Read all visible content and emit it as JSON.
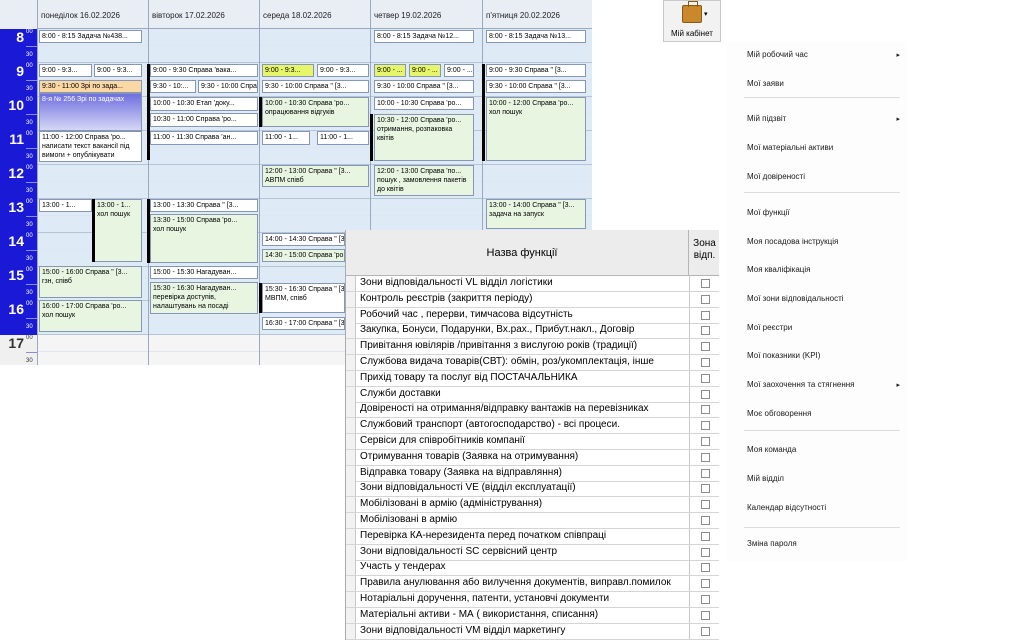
{
  "calendar": {
    "days": [
      "понеділок 16.02.2026",
      "вівторок 17.02.2026",
      "середа 18.02.2026",
      "четвер 19.02.2026",
      "п'ятниця 20.02.2026"
    ],
    "hours": [
      {
        "h": "8",
        "m": "00",
        "half": "30",
        "work": true
      },
      {
        "h": "9",
        "m": "00",
        "half": "30",
        "work": true
      },
      {
        "h": "10",
        "m": "00",
        "half": "30",
        "work": true
      },
      {
        "h": "11",
        "m": "00",
        "half": "30",
        "work": true
      },
      {
        "h": "12",
        "m": "00",
        "half": "30",
        "work": true
      },
      {
        "h": "13",
        "m": "00",
        "half": "30",
        "work": true
      },
      {
        "h": "14",
        "m": "00",
        "half": "30",
        "work": true
      },
      {
        "h": "15",
        "m": "00",
        "half": "30",
        "work": true
      },
      {
        "h": "16",
        "m": "00",
        "half": "30",
        "work": true
      },
      {
        "h": "17",
        "m": "00",
        "half": "30",
        "work": false
      }
    ],
    "events": {
      "mon_0800": "8:00 - 8:15 Задача №438...",
      "mon_0900a": "9:00 - 9:3...",
      "mon_0900b": "9:00 - 9:3...",
      "mon_0930": "9:30 - 11:00 Зрі по зада...",
      "mon_0945": "8-я № 256 Зрі по задачах",
      "mon_1100": "11:00 - 12:00 Справа 'ро...",
      "mon_1100_sub": "написати текст вакансії під вимоги + опублікувати",
      "mon_1300a": "13:00 - 1...",
      "mon_1300b": "13:00 - 1...",
      "mon_1300b_sub": "хол пошук",
      "mon_1500": "15:00 - 16:00 Справа \" [3...",
      "mon_1500_sub": "гзн, співб",
      "mon_1600": "16:00 - 17:00 Справа 'ро...",
      "mon_1600_sub": "хол пошук",
      "tue_0900": "9:00 - 9:30 Справа 'вака...",
      "tue_0930a": "9:30 - 10:...",
      "tue_0930b": "9:30 - 10:00 Справа \" [3...",
      "tue_1000": "10:00 - 10:30 Етап 'доку...",
      "tue_1030": "10:30 - 11:00 Справа 'ро...",
      "tue_1100": "11:00 - 11:30 Справа 'ан...",
      "tue_1300": "13:00 - 13:30 Справа \" [3...",
      "tue_1330": "13:30 - 15:00 Справа 'ро...",
      "tue_1330_sub": "хол пошук",
      "tue_1500": "15:00 - 15:30 Нагадуван...",
      "tue_1530": "15:30 - 16:30 Нагадуван...",
      "tue_1530_sub": "перевірка доступів, налаштувань на посаді",
      "wed_0900a": "9:00 - 9:3...",
      "wed_0900b": "9:00 - 9:3...",
      "wed_0930": "9:30 - 10:00 Справа \" [3...",
      "wed_1000": "10:00 - 10:30 Справа 'ро...",
      "wed_1000_sub": "опрацювання відгуків",
      "wed_1100a": "11:00 - 1...",
      "wed_1100b": "11:00 - 1...",
      "wed_1200": "12:00 - 13:00 Справа \" [3...",
      "wed_1200_sub": "АВПМ співб",
      "wed_1400": "14:00 - 14:30 Справа \" [3...",
      "wed_1430": "14:30 - 15:00 Справа 'ро...",
      "wed_1530": "15:30 - 16:30 Справа \" [3...",
      "wed_1530_sub": "МВПМ, співб",
      "wed_1630": "16:30 - 17:00 Справа \" [3...",
      "thu_0800": "8:00 - 8:15 Задача №12...",
      "thu_0900a": "9:00 - ...",
      "thu_0900b": "9:00 - ...",
      "thu_0900c": "9:00 - ...",
      "thu_0930": "9:30 - 10:00 Справа \" [3...",
      "thu_1000": "10:00 - 10:30 Справа 'ро...",
      "thu_1030": "10:30 - 12:00 Справа 'ро...",
      "thu_1030_sub": "отримання, розпаковка квітів",
      "thu_1200": "12:00 - 13:00 Справа 'по...",
      "thu_1200_sub": "пошук , замовлення пакетів до квітів",
      "fri_0800": "8:00 - 8:15 Задача №13...",
      "fri_0900": "9:00 - 9:30 Справа \" [3...",
      "fri_0930": "9:30 - 10:00 Справа \" [3...",
      "fri_1000": "10:00 - 12:00 Справа 'ро...",
      "fri_1000_sub": "хол пошук",
      "fri_1300": "13:00 - 14:00 Справа \" [3...",
      "fri_1300_sub": "задача на запуск"
    }
  },
  "cabinet_button": {
    "label": "Мій кабінет",
    "icon": "briefcase-icon"
  },
  "menu": {
    "items": [
      {
        "label": "Мій робочий час",
        "submenu": true
      },
      {
        "label": "Мої заяви",
        "submenu": false
      },
      {
        "label": "Мій підзвіт",
        "submenu": true
      },
      {
        "label": "Мої матеріальні активи",
        "submenu": false
      },
      {
        "label": "Мої довіреності",
        "submenu": false
      },
      {
        "label": "Мої функції",
        "submenu": false
      },
      {
        "label": "Моя посадова інструкція",
        "submenu": false
      },
      {
        "label": "Моя кваліфікація",
        "submenu": false
      },
      {
        "label": "Мої зони відповідальності",
        "submenu": false
      },
      {
        "label": "Мої реєстри",
        "submenu": false
      },
      {
        "label": "Мої показники (KPI)",
        "submenu": false
      },
      {
        "label": "Мої заохочення та стягнення",
        "submenu": true
      },
      {
        "label": "Моє обговорення",
        "submenu": false
      },
      {
        "label": "Моя команда",
        "submenu": false
      },
      {
        "label": "Мій відділ",
        "submenu": false
      },
      {
        "label": "Календар відсутності",
        "submenu": false
      },
      {
        "label": "Зміна пароля",
        "submenu": false
      }
    ],
    "arrow": "▸"
  },
  "functions_table": {
    "col_name": "Назва функції",
    "col_zone": "Зона відп.",
    "rows": [
      "Зони відповідальності  VL відділ логістики",
      "Контроль реєстрів (закриття періоду)",
      "Робочий час , перерви, тимчасова відсутність",
      "Закупка, Бонуси, Подарунки, Вх.рах., Прибут.накл., Договір",
      "Привітання ювілярів /привітання з вислугою років (традиції)",
      "Службова видача товарів(СВТ): обмін, роз/укомплектація, інше",
      "Прихід товару та послуг від ПОСТАЧАЛЬНИКА",
      "Служби доставки",
      "Довіреності на отримання/відправку вантажів на перевізниках",
      "Службовий транспорт (автогосподарство) - всі процеси.",
      "Сервіси для співробітників компанії",
      "Отримування товарів (Заявка на отримування)",
      "Відправка товару (Заявка на відправляння)",
      "Зони відповідальності VE  (відділ експлуатації)",
      "Мобілізовані в армію (адміністрування)",
      "Мобілізовані в армію",
      "Перевірка КА-нерезидента перед початком співпраці",
      "Зони відповідальності SC  сервісний центр",
      "Участь у тендерах",
      "Правила анулювання або вилучення документів, виправл.помилок",
      "Нотаріальні доручення, патенти, установчі документи",
      "Матеріальні  активи - МА  ( використання, списання)",
      "Зони відповідальності VM  відділ маркетингу"
    ]
  }
}
